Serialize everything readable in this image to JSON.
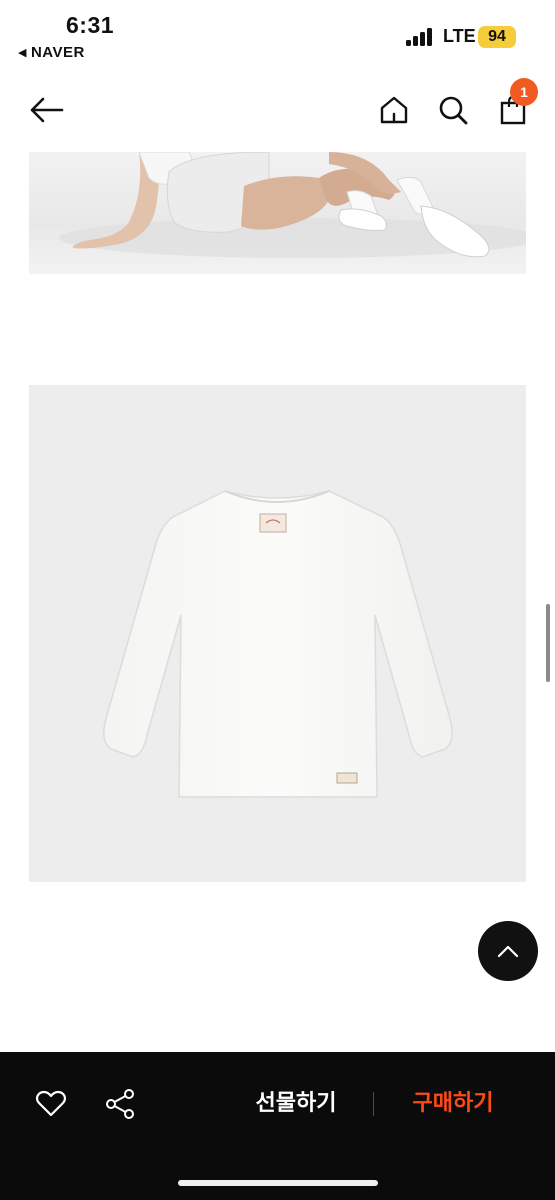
{
  "status_bar": {
    "time": "6:31",
    "back_app": "NAVER",
    "network": "LTE",
    "battery": "94"
  },
  "header": {
    "cart_count": "1",
    "icons": [
      "back-arrow-icon",
      "home-icon",
      "search-icon",
      "shopping-bag-icon"
    ]
  },
  "bottom_bar": {
    "gift_label": "선물하기",
    "buy_label": "구매하기",
    "icons": [
      "heart-icon",
      "share-icon"
    ]
  },
  "colors": {
    "accent": "#f15a22",
    "buy_text": "#ff4a17",
    "battery": "#f6cc3a",
    "bottom_bar_bg": "#0b0b0b"
  }
}
